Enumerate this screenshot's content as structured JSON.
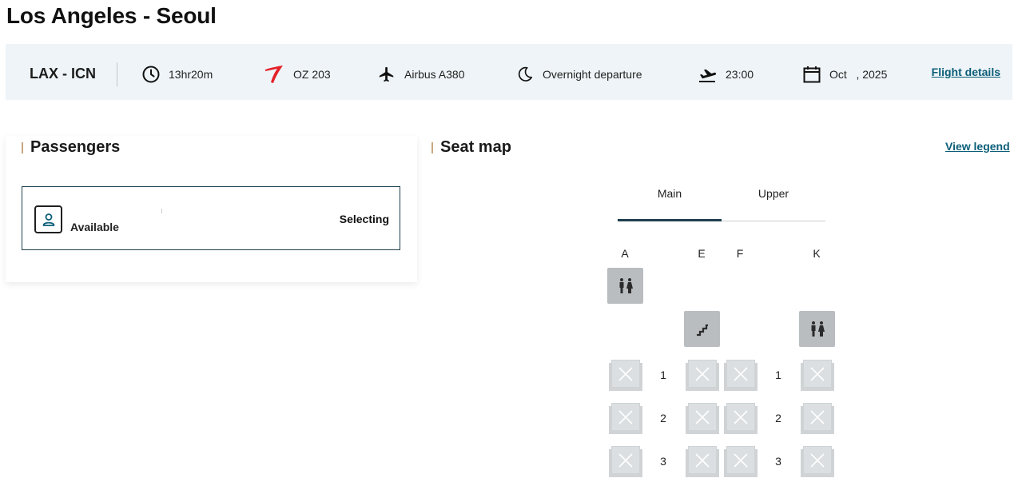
{
  "page": {
    "title": "Los Angeles - Seoul"
  },
  "flight_bar": {
    "route": "LAX - ICN",
    "duration": "13hr20m",
    "flight_number": "OZ 203",
    "aircraft": "Airbus A380",
    "departure_type": "Overnight departure",
    "departure_time": "23:00",
    "date": "Oct   , 2025",
    "details_link": "Flight details",
    "icons": [
      "clock-icon",
      "airline-logo",
      "plane-icon",
      "moon-icon",
      "takeoff-icon",
      "calendar-icon"
    ],
    "airline_color": "#e4202a"
  },
  "passengers": {
    "title": "Passengers",
    "card": {
      "status": "Available",
      "action": "Selecting"
    }
  },
  "seat_map": {
    "title": "Seat map",
    "legend_link": "View legend",
    "tabs": [
      {
        "label": "Main",
        "active": true
      },
      {
        "label": "Upper",
        "active": false
      }
    ],
    "columns": [
      "A",
      "E",
      "F",
      "K"
    ],
    "rows": [
      {
        "number": "1"
      },
      {
        "number": "2"
      },
      {
        "number": "3"
      }
    ],
    "facilities": [
      "lavatory-icon",
      "stairs-icon",
      "lavatory-icon"
    ],
    "seat_status": "unavailable"
  },
  "colors": {
    "accent": "#0b5e78",
    "bar_bg": "#eef4f7",
    "section_marker": "#c9a77e"
  }
}
